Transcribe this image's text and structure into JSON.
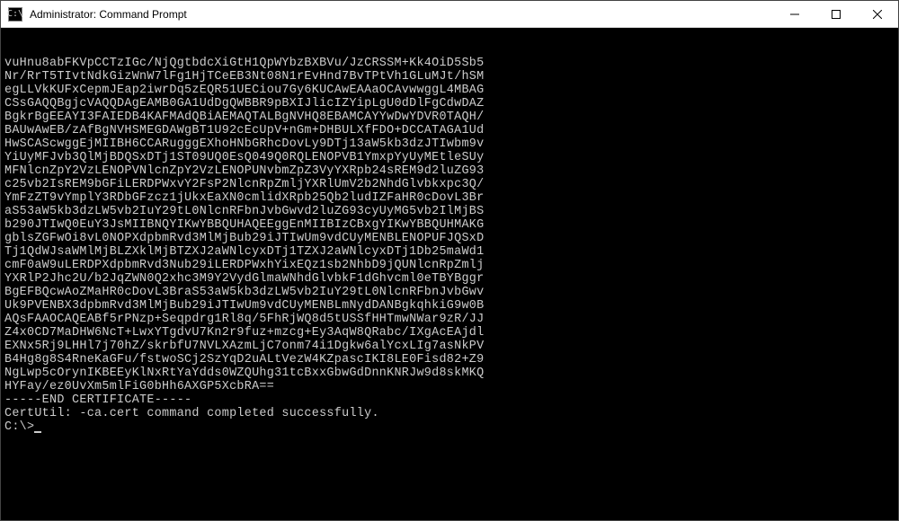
{
  "window": {
    "title": "Administrator: Command Prompt"
  },
  "terminal": {
    "lines": [
      "vuHnu8abFKVpCCTzIGc/NjQgtbdcXiGtH1QpWYbzBXBVu/JzCRSSM+Kk4OiD5Sb5",
      "Nr/RrT5TIvtNdkGizWnW7lFg1HjTCeEB3Nt08N1rEvHnd7BvTPtVh1GLuMJt/hSM",
      "egLLVkKUFxCepmJEap2iwrDq5zEQR51UECiou7Gy6KUCAwEAAaOCAvwwggL4MBAG",
      "CSsGAQQBgjcVAQQDAgEAMB0GA1UdDgQWBBR9pBXIJlicIZYipLgU0dDlFgCdwDAZ",
      "BgkrBgEEAYI3FAIEDB4KAFMAdQBiAEMAQTALBgNVHQ8EBAMCAYYwDwYDVR0TAQH/",
      "BAUwAwEB/zAfBgNVHSMEGDAWgBT1U92cEcUpV+nGm+DHBULXfFDO+DCCATAGA1Ud",
      "HwSCAScwggEjMIIBH6CCARugggEXhoHNbGRhcDovLy9DTj13aW5kb3dzJTIwbm9v",
      "YiUyMFJvb3QlMjBDQSxDTj1ST09UQ0EsQ049Q0RQLENOPVB1YmxpYyUyMEtleSUy",
      "MFNlcnZpY2VzLENOPVNlcnZpY2VzLENOPUNvbmZpZ3VyYXRpb24sREM9d2luZG93",
      "c25vb2IsREM9bGFiLERDPWxvY2FsP2NlcnRpZmljYXRlUmV2b2NhdGlvbkxpc3Q/",
      "YmFzZT9vYmplY3RDbGFzcz1jUkxEaXN0cmlidXRpb25Qb2ludIZFaHR0cDovL3Br",
      "aS53aW5kb3dzLW5vb2IuY29tL0NlcnRFbnJvbGwvd2luZG93cyUyMG5vb2IlMjBS",
      "b290JTIwQ0EuY3JsMIIBNQYIKwYBBQUHAQEEggEnMIIBIzCBxgYIKwYBBQUHMAKG",
      "gblsZGFwOi8vL0NOPXdpbmRvd3MlMjBub29iJTIwUm9vdCUyMENBLENOPUFJQSxD",
      "Tj1QdWJsaWMlMjBLZXklMjBTZXJ2aWNlcyxDTj1TZXJ2aWNlcyxDTj1Db25maWd1",
      "cmF0aW9uLERDPXdpbmRvd3Nub29iLERDPWxhYixEQz1sb2NhbD9jQUNlcnRpZmlj",
      "YXRlP2Jhc2U/b2JqZWN0Q2xhc3M9Y2VydGlmaWNhdGlvbkF1dGhvcml0eTBYBggr",
      "BgEFBQcwAoZMaHR0cDovL3BraS53aW5kb3dzLW5vb2IuY29tL0NlcnRFbnJvbGwv",
      "Uk9PVENBX3dpbmRvd3MlMjBub29iJTIwUm9vdCUyMENBLmNydDANBgkqhkiG9w0B",
      "AQsFAAOCAQEABf5rPNzp+Seqpdrg1Rl8q/5FhRjWQ8d5tUSSfHHTmwNWar9zR/JJ",
      "Z4x0CD7MaDHW6NcT+LwxYTgdvU7Kn2r9fuz+mzcg+Ey3AqW8QRabc/IXgAcEAjdl",
      "EXNx5Rj9LHHl7j70hZ/skrbfU7NVLXAzmLjC7onm74i1Dgkw6alYcxLIg7asNkPV",
      "B4Hg8g8S4RneKaGFu/fstwoSCj2SzYqD2uALtVezW4KZpascIKI8LE0Fisd82+Z9",
      "NgLwp5cOrynIKBEEyKlNxRtYaYdds0WZQUhg31tcBxxGbwGdDnnKNRJw9d8skMKQ",
      "HYFay/ez0UvXm5mlFiG0bHh6AXGP5XcbRA==",
      "-----END CERTIFICATE-----",
      "",
      "CertUtil: -ca.cert command completed successfully.",
      ""
    ],
    "prompt": "C:\\>"
  }
}
